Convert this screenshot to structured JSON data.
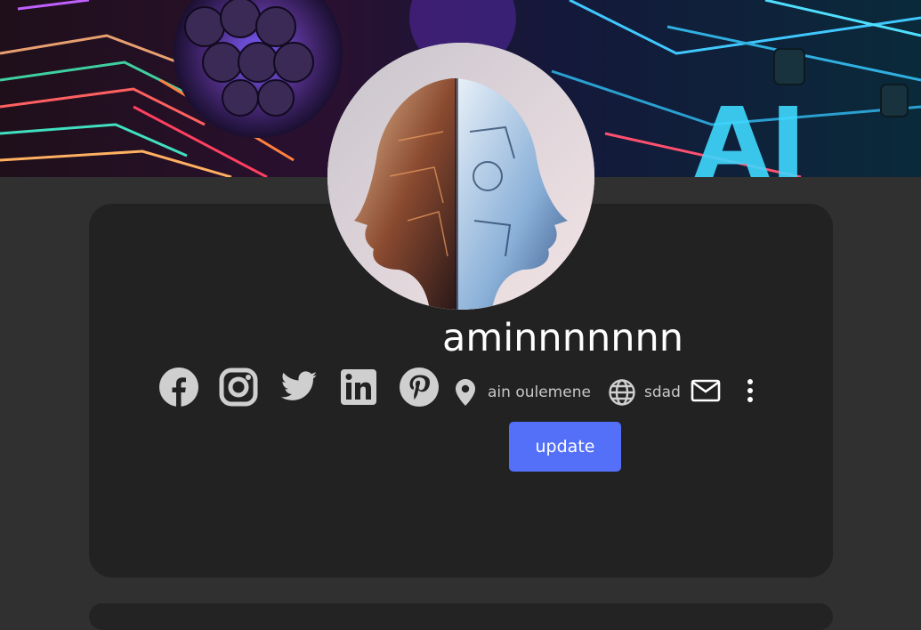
{
  "profile": {
    "username": "aminnnnnnn",
    "location": "ain oulemene",
    "website": "sdad",
    "update_label": "update"
  },
  "banner": {
    "text": "AI"
  },
  "social_links": [
    {
      "name": "facebook",
      "icon": "facebook-icon"
    },
    {
      "name": "instagram",
      "icon": "instagram-icon"
    },
    {
      "name": "twitter",
      "icon": "twitter-icon"
    },
    {
      "name": "linkedin",
      "icon": "linkedin-icon"
    },
    {
      "name": "pinterest",
      "icon": "pinterest-icon"
    }
  ],
  "colors": {
    "page_background": "#303030",
    "card_background": "#222222",
    "accent": "#5470f8",
    "icon": "#cfcfcf"
  }
}
